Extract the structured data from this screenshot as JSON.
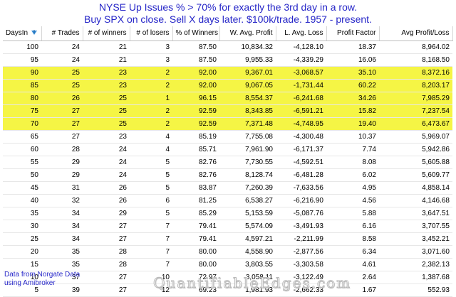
{
  "title": {
    "line1": "NYSE Up Issues % > 70% for exactly the 3rd day in a row.",
    "line2": "Buy SPX on close. Sell X days later. $100k/trade. 1957 - present."
  },
  "columns": [
    "DaysIn",
    "# Trades",
    "# of winners",
    "# of losers",
    "% of Winners",
    "W. Avg. Profit",
    "L. Avg. Loss",
    "Profit Factor",
    "Avg Profit/Loss"
  ],
  "sort_icon": "sort-descending-icon",
  "highlight_color": "#f5f545",
  "rows": [
    {
      "cells": [
        "100",
        "24",
        "21",
        "3",
        "87.50",
        "10,834.32",
        "-4,128.10",
        "18.37",
        "8,964.02"
      ],
      "highlight": false
    },
    {
      "cells": [
        "95",
        "24",
        "21",
        "3",
        "87.50",
        "9,955.33",
        "-4,339.29",
        "16.06",
        "8,168.50"
      ],
      "highlight": false
    },
    {
      "cells": [
        "90",
        "25",
        "23",
        "2",
        "92.00",
        "9,367.01",
        "-3,068.57",
        "35.10",
        "8,372.16"
      ],
      "highlight": true
    },
    {
      "cells": [
        "85",
        "25",
        "23",
        "2",
        "92.00",
        "9,067.05",
        "-1,731.44",
        "60.22",
        "8,203.17"
      ],
      "highlight": true
    },
    {
      "cells": [
        "80",
        "26",
        "25",
        "1",
        "96.15",
        "8,554.37",
        "-6,241.68",
        "34.26",
        "7,985.29"
      ],
      "highlight": true
    },
    {
      "cells": [
        "75",
        "27",
        "25",
        "2",
        "92.59",
        "8,343.85",
        "-6,591.21",
        "15.82",
        "7,237.54"
      ],
      "highlight": true
    },
    {
      "cells": [
        "70",
        "27",
        "25",
        "2",
        "92.59",
        "7,371.48",
        "-4,748.95",
        "19.40",
        "6,473.67"
      ],
      "highlight": true
    },
    {
      "cells": [
        "65",
        "27",
        "23",
        "4",
        "85.19",
        "7,755.08",
        "-4,300.48",
        "10.37",
        "5,969.07"
      ],
      "highlight": false
    },
    {
      "cells": [
        "60",
        "28",
        "24",
        "4",
        "85.71",
        "7,961.90",
        "-6,171.37",
        "7.74",
        "5,942.86"
      ],
      "highlight": false
    },
    {
      "cells": [
        "55",
        "29",
        "24",
        "5",
        "82.76",
        "7,730.55",
        "-4,592.51",
        "8.08",
        "5,605.88"
      ],
      "highlight": false
    },
    {
      "cells": [
        "50",
        "29",
        "24",
        "5",
        "82.76",
        "8,128.74",
        "-6,481.28",
        "6.02",
        "5,609.77"
      ],
      "highlight": false
    },
    {
      "cells": [
        "45",
        "31",
        "26",
        "5",
        "83.87",
        "7,260.39",
        "-7,633.56",
        "4.95",
        "4,858.14"
      ],
      "highlight": false
    },
    {
      "cells": [
        "40",
        "32",
        "26",
        "6",
        "81.25",
        "6,538.27",
        "-6,216.90",
        "4.56",
        "4,146.68"
      ],
      "highlight": false
    },
    {
      "cells": [
        "35",
        "34",
        "29",
        "5",
        "85.29",
        "5,153.59",
        "-5,087.76",
        "5.88",
        "3,647.51"
      ],
      "highlight": false
    },
    {
      "cells": [
        "30",
        "34",
        "27",
        "7",
        "79.41",
        "5,574.09",
        "-3,491.93",
        "6.16",
        "3,707.55"
      ],
      "highlight": false
    },
    {
      "cells": [
        "25",
        "34",
        "27",
        "7",
        "79.41",
        "4,597.21",
        "-2,211.99",
        "8.58",
        "3,452.21"
      ],
      "highlight": false
    },
    {
      "cells": [
        "20",
        "35",
        "28",
        "7",
        "80.00",
        "4,558.90",
        "-2,877.56",
        "6.34",
        "3,071.60"
      ],
      "highlight": false
    },
    {
      "cells": [
        "15",
        "35",
        "28",
        "7",
        "80.00",
        "3,803.55",
        "-3,303.58",
        "4.61",
        "2,382.13"
      ],
      "highlight": false
    },
    {
      "cells": [
        "10",
        "37",
        "27",
        "10",
        "72.97",
        "3,058.11",
        "-3,122.49",
        "2.64",
        "1,387.68"
      ],
      "highlight": false
    },
    {
      "cells": [
        "5",
        "39",
        "27",
        "12",
        "69.23",
        "1,981.93",
        "-2,662.33",
        "1.67",
        "552.93"
      ],
      "highlight": false
    }
  ],
  "footer": {
    "line1": "Data from Norgate Data",
    "line2": "using Amibroker"
  },
  "watermark": "QuantifiableEdges.com"
}
